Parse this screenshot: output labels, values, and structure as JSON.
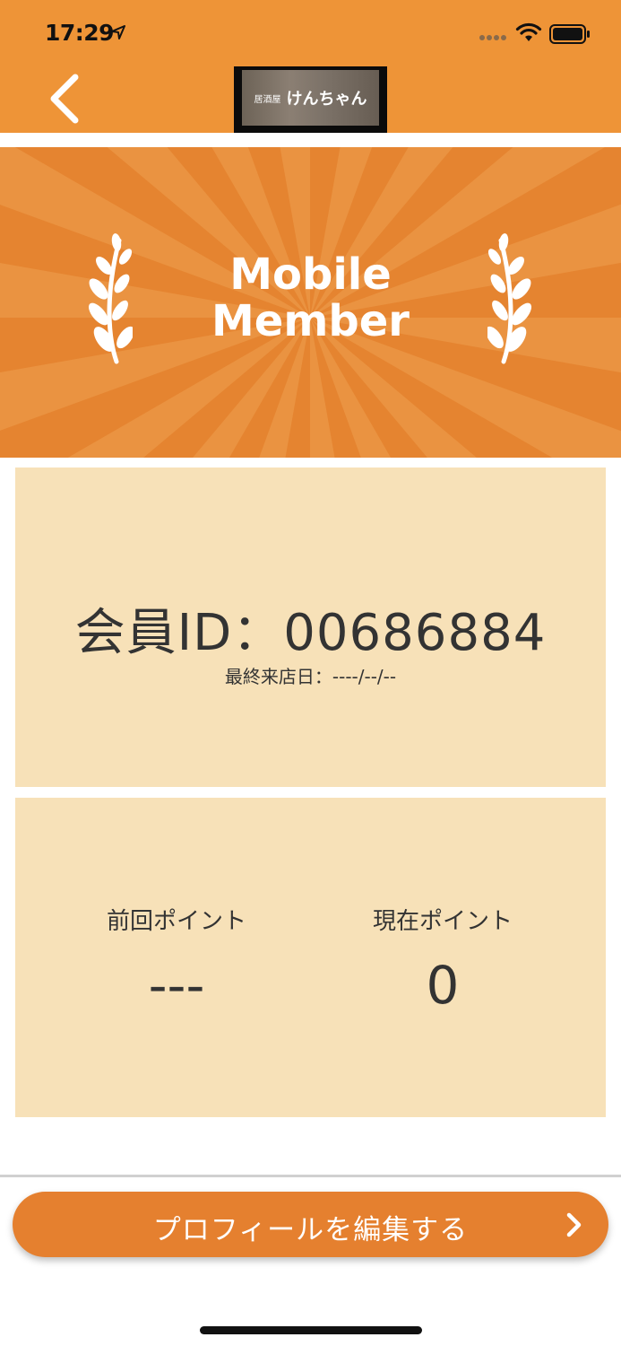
{
  "status_bar": {
    "time": "17:29",
    "icons": [
      "location-arrow-icon",
      "signal-dots-icon",
      "wifi-icon",
      "battery-icon"
    ]
  },
  "nav": {
    "back_icon": "chevron-left-icon",
    "logo": {
      "small_text": "居酒屋",
      "main_text": "けんちゃん"
    }
  },
  "banner": {
    "title_line1": "Mobile",
    "title_line2": "Member",
    "colors": {
      "ray_dark": "#e58430",
      "ray_light": "#ea9341"
    }
  },
  "member": {
    "id_text": "会員ID：00686884",
    "last_visit": "最終来店日：----/--/--"
  },
  "points": {
    "previous_label": "前回ポイント",
    "previous_value": "---",
    "current_label": "現在ポイント",
    "current_value": "0"
  },
  "actions": {
    "edit_profile_label": "プロフィールを編集する",
    "edit_icon": "chevron-right-icon"
  },
  "colors": {
    "header_orange": "#ee9437",
    "button_orange": "#e5802f",
    "card_beige": "#f7e1b8"
  }
}
